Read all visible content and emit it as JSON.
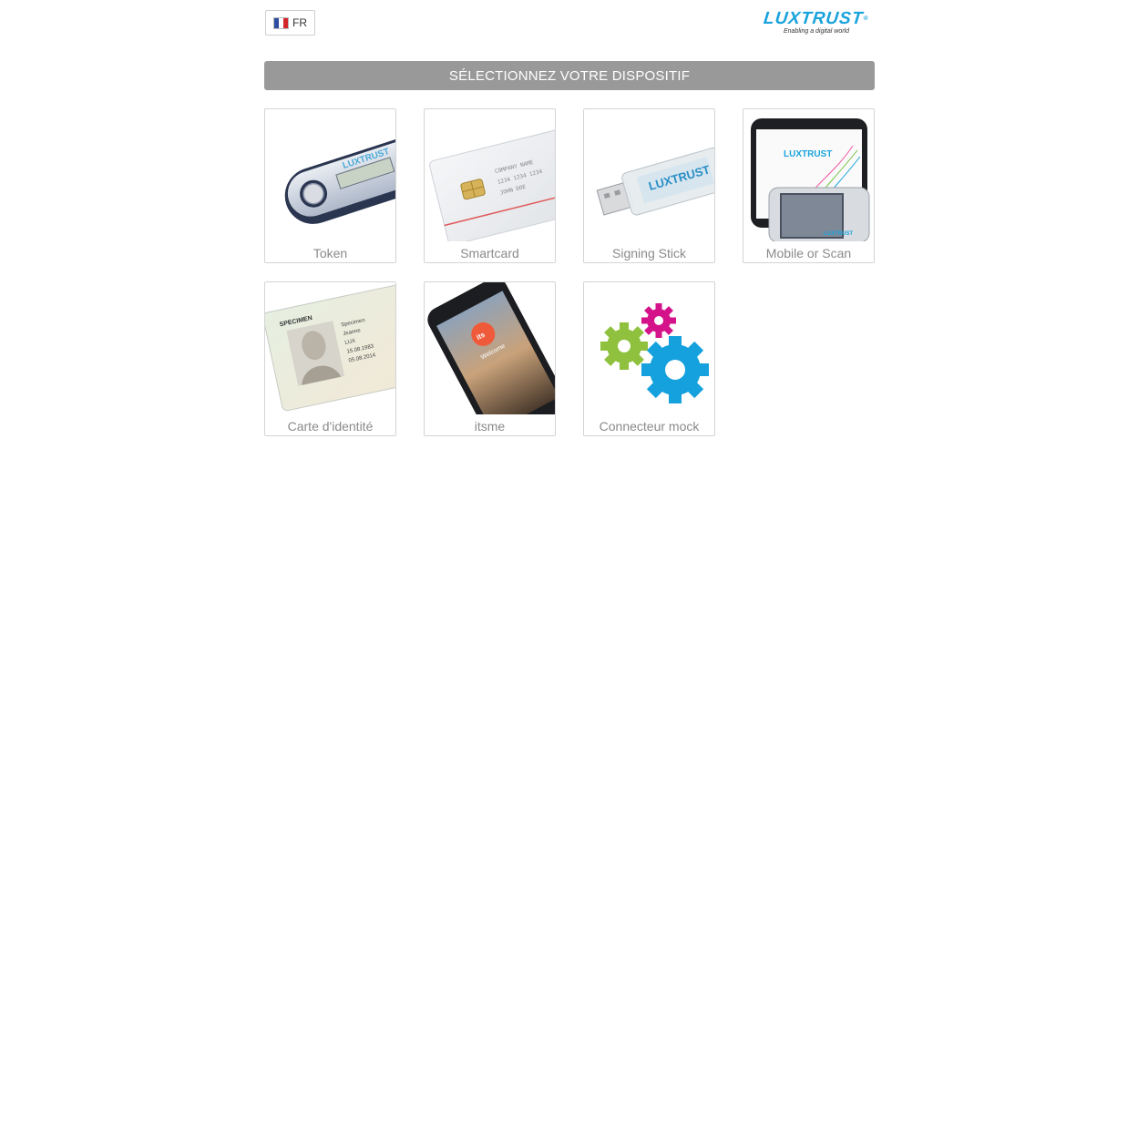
{
  "language": {
    "code": "FR",
    "flag": "france-flag"
  },
  "brand": {
    "name": "LUXTRUST",
    "tagline": "Enabling a digital world",
    "color": "#1aa3dc"
  },
  "banner": {
    "title": "SÉLECTIONNEZ VOTRE DISPOSITIF",
    "color": "#999999"
  },
  "devices": [
    {
      "label": "Token",
      "icon": "token-image"
    },
    {
      "label": "Smartcard",
      "icon": "smartcard-image"
    },
    {
      "label": "Signing Stick",
      "icon": "signing-stick-image"
    },
    {
      "label": "Mobile or Scan",
      "icon": "mobile-scan-image"
    },
    {
      "label": "Carte d'identité",
      "icon": "id-card-image"
    },
    {
      "label": "itsme",
      "icon": "itsme-phone-image"
    },
    {
      "label": "Connecteur mock",
      "icon": "gears-icon"
    }
  ]
}
